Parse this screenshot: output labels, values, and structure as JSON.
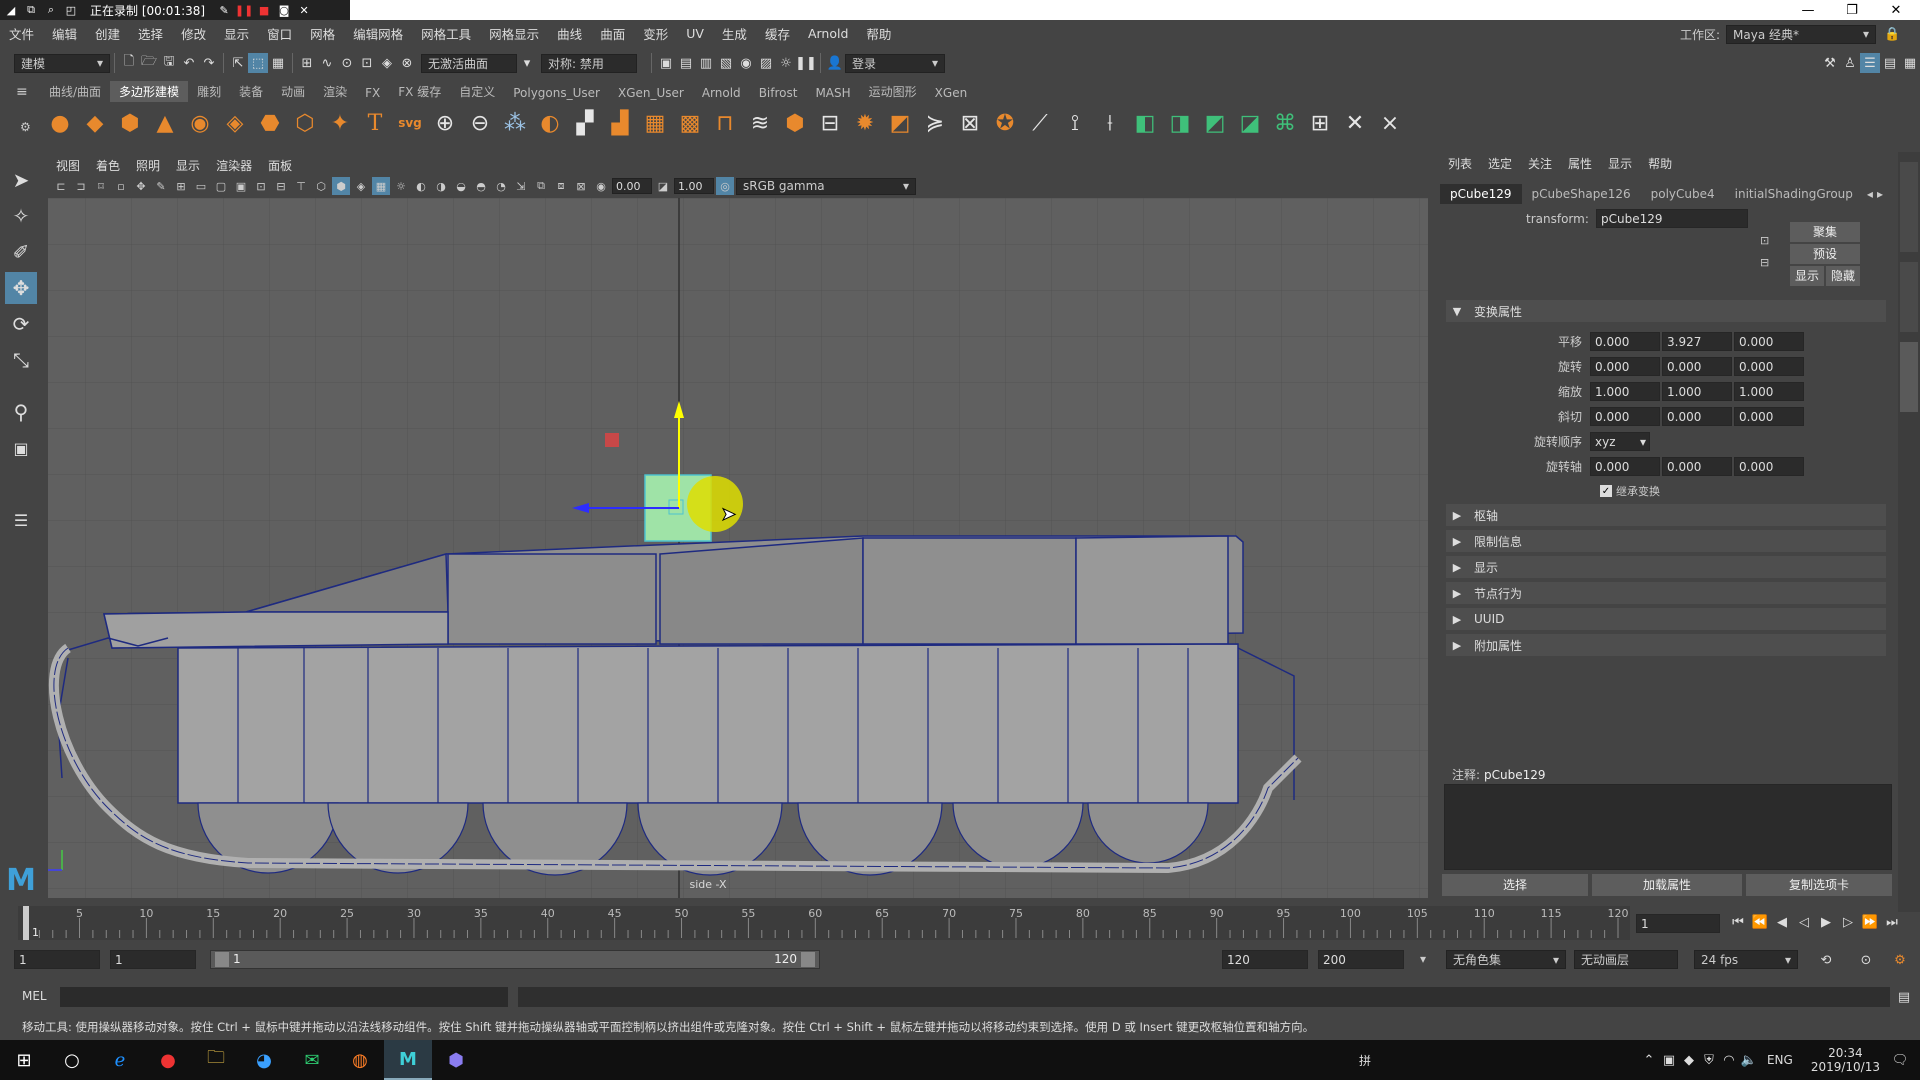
{
  "titlebar": {
    "recording": "正在录制 [00:01:38]",
    "minimize": "—",
    "restore": "❐",
    "close": "✕"
  },
  "menubar": {
    "items": [
      "文件",
      "编辑",
      "创建",
      "选择",
      "修改",
      "显示",
      "窗口",
      "网格",
      "编辑网格",
      "网格工具",
      "网格显示",
      "曲线",
      "曲面",
      "变形",
      "UV",
      "生成",
      "缓存",
      "Arnold",
      "帮助"
    ],
    "workspace_label": "工作区:",
    "workspace_value": "Maya 经典*"
  },
  "statusline": {
    "mode": "建模",
    "live_surface": "无激活曲面",
    "symmetry": "对称: 禁用",
    "login": "登录"
  },
  "shelf": {
    "tabs": [
      "曲线/曲面",
      "多边形建模",
      "雕刻",
      "装备",
      "动画",
      "渲染",
      "FX",
      "FX 缓存",
      "自定义",
      "Polygons_User",
      "XGen_User",
      "Arnold",
      "Bifrost",
      "MASH",
      "运动图形",
      "XGen"
    ],
    "active_tab": 1
  },
  "viewport": {
    "menu": [
      "视图",
      "着色",
      "照明",
      "显示",
      "渲染器",
      "面板"
    ],
    "exposure": "0.00",
    "gamma": "1.00",
    "colorspace": "sRGB gamma",
    "camera_label": "side -X"
  },
  "attribute_editor": {
    "menu": [
      "列表",
      "选定",
      "关注",
      "属性",
      "显示",
      "帮助"
    ],
    "tabs": [
      "pCube129",
      "pCubeShape126",
      "polyCube4",
      "initialShadingGroup"
    ],
    "transform_label": "transform:",
    "transform_value": "pCube129",
    "btn_focus": "聚集",
    "btn_preset": "预设",
    "btn_show": "显示",
    "btn_hide": "隐藏",
    "section_transform": "变换属性",
    "translate_label": "平移",
    "translate": [
      "0.000",
      "3.927",
      "0.000"
    ],
    "rotate_label": "旋转",
    "rotate": [
      "0.000",
      "0.000",
      "0.000"
    ],
    "scale_label": "缩放",
    "scale": [
      "1.000",
      "1.000",
      "1.000"
    ],
    "shear_label": "斜切",
    "shear": [
      "0.000",
      "0.000",
      "0.000"
    ],
    "rotate_order_label": "旋转顺序",
    "rotate_order": "xyz",
    "rotate_axis_label": "旋转轴",
    "rotate_axis": [
      "0.000",
      "0.000",
      "0.000"
    ],
    "inherit_label": "继承变换",
    "collapsed_sections": [
      "枢轴",
      "限制信息",
      "显示",
      "节点行为",
      "UUID",
      "附加属性"
    ],
    "notes_label": "注释:",
    "notes_value": "pCube129",
    "bottom_buttons": [
      "选择",
      "加载属性",
      "复制选项卡"
    ]
  },
  "timeline": {
    "ticks": [
      "5",
      "10",
      "15",
      "20",
      "25",
      "30",
      "35",
      "40",
      "45",
      "50",
      "55",
      "60",
      "65",
      "70",
      "75",
      "80",
      "85",
      "90",
      "95",
      "100",
      "105",
      "110",
      "115",
      "120"
    ],
    "current_frame": "1",
    "start_tick": "1"
  },
  "range": {
    "start": "1",
    "anim_start": "1",
    "slider_start": "1",
    "slider_end": "120",
    "anim_end": "120",
    "end": "200",
    "character_set": "无角色集",
    "anim_layer": "无动画层",
    "fps": "24 fps"
  },
  "cmdline": {
    "label": "MEL"
  },
  "help_line": "移动工具: 使用操纵器移动对象。按住 Ctrl + 鼠标中键并拖动以沿法线移动组件。按住 Shift 键并拖动操纵器轴或平面控制柄以挤出组件或克隆对象。按住 Ctrl + Shift + 鼠标左键并拖动以将移动约束到选择。使用 D 或 Insert 键更改枢轴位置和轴方向。",
  "taskbar": {
    "ime": "拼",
    "lang": "ENG",
    "time": "20:34",
    "date": "2019/10/13"
  },
  "colors": {
    "accent": "#5285a6",
    "viewport_bg": "#606060",
    "selection_green": "#9fe3a7",
    "manip_yellow": "#ffff00",
    "manip_blue": "#2d2dff"
  }
}
